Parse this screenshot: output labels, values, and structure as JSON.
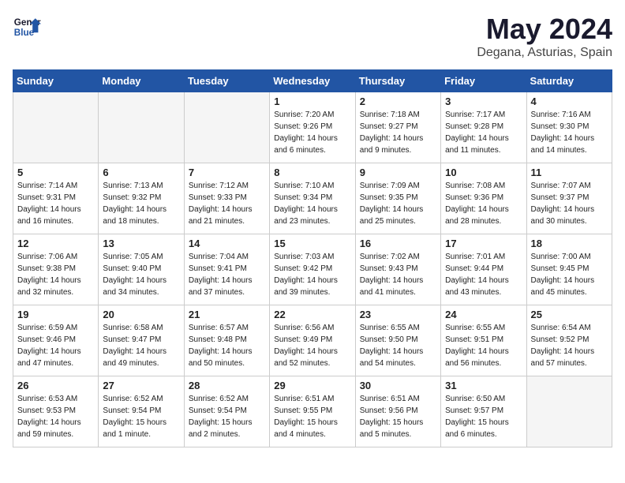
{
  "header": {
    "logo_line1": "General",
    "logo_line2": "Blue",
    "month": "May 2024",
    "location": "Degana, Asturias, Spain"
  },
  "weekdays": [
    "Sunday",
    "Monday",
    "Tuesday",
    "Wednesday",
    "Thursday",
    "Friday",
    "Saturday"
  ],
  "weeks": [
    [
      {
        "day": "",
        "sunrise": "",
        "sunset": "",
        "daylight": ""
      },
      {
        "day": "",
        "sunrise": "",
        "sunset": "",
        "daylight": ""
      },
      {
        "day": "",
        "sunrise": "",
        "sunset": "",
        "daylight": ""
      },
      {
        "day": "1",
        "sunrise": "Sunrise: 7:20 AM",
        "sunset": "Sunset: 9:26 PM",
        "daylight": "Daylight: 14 hours and 6 minutes."
      },
      {
        "day": "2",
        "sunrise": "Sunrise: 7:18 AM",
        "sunset": "Sunset: 9:27 PM",
        "daylight": "Daylight: 14 hours and 9 minutes."
      },
      {
        "day": "3",
        "sunrise": "Sunrise: 7:17 AM",
        "sunset": "Sunset: 9:28 PM",
        "daylight": "Daylight: 14 hours and 11 minutes."
      },
      {
        "day": "4",
        "sunrise": "Sunrise: 7:16 AM",
        "sunset": "Sunset: 9:30 PM",
        "daylight": "Daylight: 14 hours and 14 minutes."
      }
    ],
    [
      {
        "day": "5",
        "sunrise": "Sunrise: 7:14 AM",
        "sunset": "Sunset: 9:31 PM",
        "daylight": "Daylight: 14 hours and 16 minutes."
      },
      {
        "day": "6",
        "sunrise": "Sunrise: 7:13 AM",
        "sunset": "Sunset: 9:32 PM",
        "daylight": "Daylight: 14 hours and 18 minutes."
      },
      {
        "day": "7",
        "sunrise": "Sunrise: 7:12 AM",
        "sunset": "Sunset: 9:33 PM",
        "daylight": "Daylight: 14 hours and 21 minutes."
      },
      {
        "day": "8",
        "sunrise": "Sunrise: 7:10 AM",
        "sunset": "Sunset: 9:34 PM",
        "daylight": "Daylight: 14 hours and 23 minutes."
      },
      {
        "day": "9",
        "sunrise": "Sunrise: 7:09 AM",
        "sunset": "Sunset: 9:35 PM",
        "daylight": "Daylight: 14 hours and 25 minutes."
      },
      {
        "day": "10",
        "sunrise": "Sunrise: 7:08 AM",
        "sunset": "Sunset: 9:36 PM",
        "daylight": "Daylight: 14 hours and 28 minutes."
      },
      {
        "day": "11",
        "sunrise": "Sunrise: 7:07 AM",
        "sunset": "Sunset: 9:37 PM",
        "daylight": "Daylight: 14 hours and 30 minutes."
      }
    ],
    [
      {
        "day": "12",
        "sunrise": "Sunrise: 7:06 AM",
        "sunset": "Sunset: 9:38 PM",
        "daylight": "Daylight: 14 hours and 32 minutes."
      },
      {
        "day": "13",
        "sunrise": "Sunrise: 7:05 AM",
        "sunset": "Sunset: 9:40 PM",
        "daylight": "Daylight: 14 hours and 34 minutes."
      },
      {
        "day": "14",
        "sunrise": "Sunrise: 7:04 AM",
        "sunset": "Sunset: 9:41 PM",
        "daylight": "Daylight: 14 hours and 37 minutes."
      },
      {
        "day": "15",
        "sunrise": "Sunrise: 7:03 AM",
        "sunset": "Sunset: 9:42 PM",
        "daylight": "Daylight: 14 hours and 39 minutes."
      },
      {
        "day": "16",
        "sunrise": "Sunrise: 7:02 AM",
        "sunset": "Sunset: 9:43 PM",
        "daylight": "Daylight: 14 hours and 41 minutes."
      },
      {
        "day": "17",
        "sunrise": "Sunrise: 7:01 AM",
        "sunset": "Sunset: 9:44 PM",
        "daylight": "Daylight: 14 hours and 43 minutes."
      },
      {
        "day": "18",
        "sunrise": "Sunrise: 7:00 AM",
        "sunset": "Sunset: 9:45 PM",
        "daylight": "Daylight: 14 hours and 45 minutes."
      }
    ],
    [
      {
        "day": "19",
        "sunrise": "Sunrise: 6:59 AM",
        "sunset": "Sunset: 9:46 PM",
        "daylight": "Daylight: 14 hours and 47 minutes."
      },
      {
        "day": "20",
        "sunrise": "Sunrise: 6:58 AM",
        "sunset": "Sunset: 9:47 PM",
        "daylight": "Daylight: 14 hours and 49 minutes."
      },
      {
        "day": "21",
        "sunrise": "Sunrise: 6:57 AM",
        "sunset": "Sunset: 9:48 PM",
        "daylight": "Daylight: 14 hours and 50 minutes."
      },
      {
        "day": "22",
        "sunrise": "Sunrise: 6:56 AM",
        "sunset": "Sunset: 9:49 PM",
        "daylight": "Daylight: 14 hours and 52 minutes."
      },
      {
        "day": "23",
        "sunrise": "Sunrise: 6:55 AM",
        "sunset": "Sunset: 9:50 PM",
        "daylight": "Daylight: 14 hours and 54 minutes."
      },
      {
        "day": "24",
        "sunrise": "Sunrise: 6:55 AM",
        "sunset": "Sunset: 9:51 PM",
        "daylight": "Daylight: 14 hours and 56 minutes."
      },
      {
        "day": "25",
        "sunrise": "Sunrise: 6:54 AM",
        "sunset": "Sunset: 9:52 PM",
        "daylight": "Daylight: 14 hours and 57 minutes."
      }
    ],
    [
      {
        "day": "26",
        "sunrise": "Sunrise: 6:53 AM",
        "sunset": "Sunset: 9:53 PM",
        "daylight": "Daylight: 14 hours and 59 minutes."
      },
      {
        "day": "27",
        "sunrise": "Sunrise: 6:52 AM",
        "sunset": "Sunset: 9:54 PM",
        "daylight": "Daylight: 15 hours and 1 minute."
      },
      {
        "day": "28",
        "sunrise": "Sunrise: 6:52 AM",
        "sunset": "Sunset: 9:54 PM",
        "daylight": "Daylight: 15 hours and 2 minutes."
      },
      {
        "day": "29",
        "sunrise": "Sunrise: 6:51 AM",
        "sunset": "Sunset: 9:55 PM",
        "daylight": "Daylight: 15 hours and 4 minutes."
      },
      {
        "day": "30",
        "sunrise": "Sunrise: 6:51 AM",
        "sunset": "Sunset: 9:56 PM",
        "daylight": "Daylight: 15 hours and 5 minutes."
      },
      {
        "day": "31",
        "sunrise": "Sunrise: 6:50 AM",
        "sunset": "Sunset: 9:57 PM",
        "daylight": "Daylight: 15 hours and 6 minutes."
      },
      {
        "day": "",
        "sunrise": "",
        "sunset": "",
        "daylight": ""
      }
    ]
  ]
}
